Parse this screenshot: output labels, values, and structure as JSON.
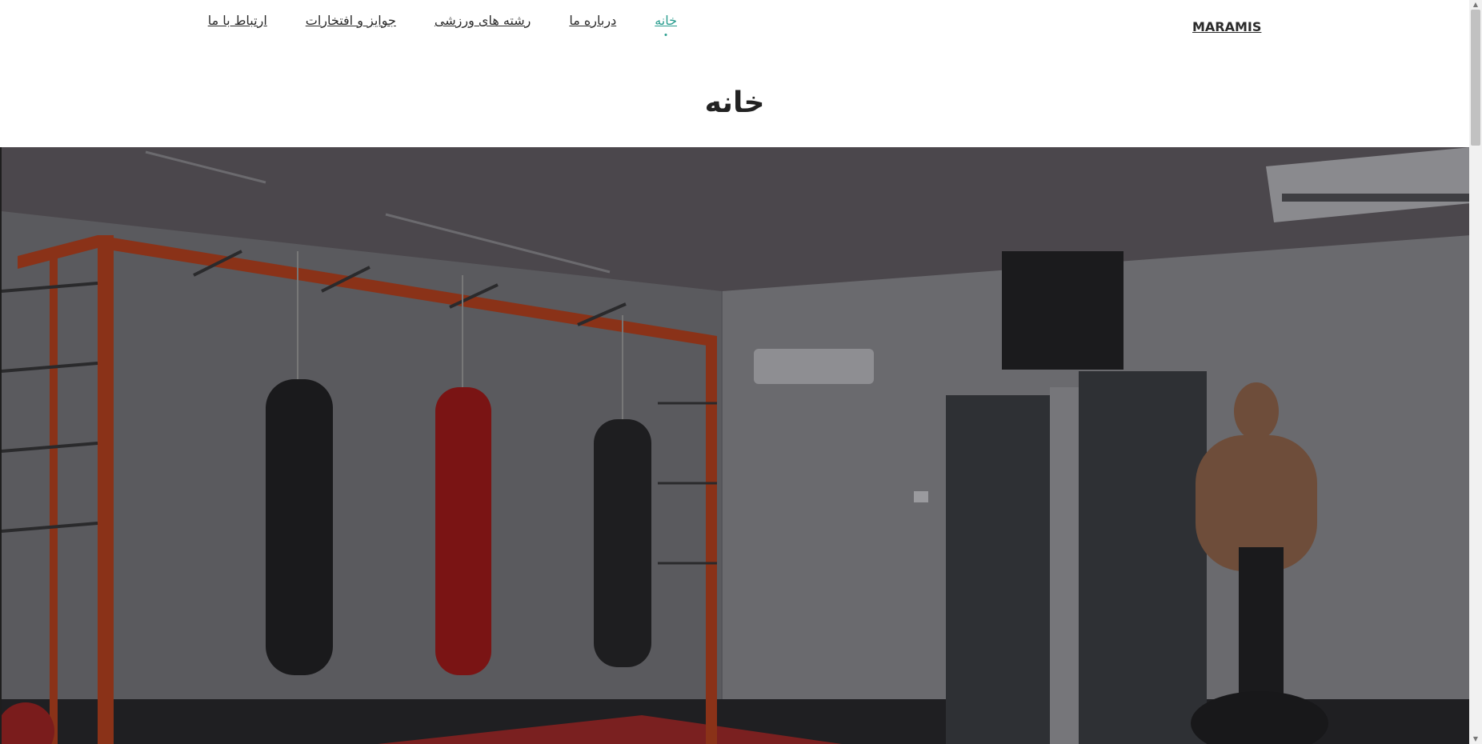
{
  "brand": {
    "name": "MARAMIS"
  },
  "nav": {
    "items": [
      {
        "label": "خانه",
        "active": true
      },
      {
        "label": "درباره ما"
      },
      {
        "label": "رشته های ورزشی"
      },
      {
        "label": "جوایز و افتخارات"
      },
      {
        "label": "ارتباط با ما"
      }
    ]
  },
  "page": {
    "title": "خانه"
  },
  "colors": {
    "accent": "#2a9d8f",
    "text": "#2b2b2b",
    "background": "#ffffff"
  },
  "icons": {
    "scroll_up": "arrow-up-icon",
    "scroll_down": "arrow-down-icon"
  }
}
